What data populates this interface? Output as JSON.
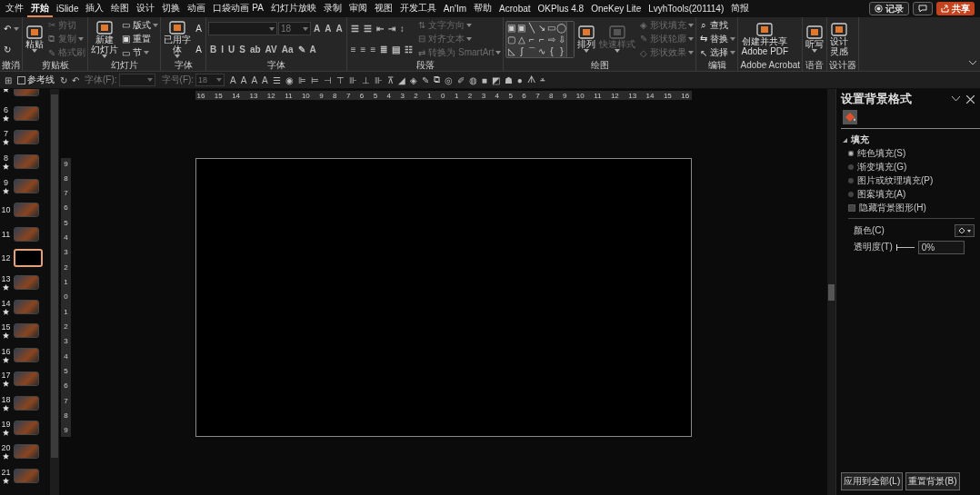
{
  "menu_tabs": [
    {
      "label": "文件",
      "selected": false
    },
    {
      "label": "开始",
      "selected": true
    },
    {
      "label": "iSlide",
      "selected": false
    },
    {
      "label": "插入",
      "selected": false
    },
    {
      "label": "绘图",
      "selected": false
    },
    {
      "label": "设计",
      "selected": false
    },
    {
      "label": "切换",
      "selected": false
    },
    {
      "label": "动画",
      "selected": false
    },
    {
      "label": "口袋动画 PA",
      "selected": false
    },
    {
      "label": "幻灯片放映",
      "selected": false
    },
    {
      "label": "录制",
      "selected": false
    },
    {
      "label": "审阅",
      "selected": false
    },
    {
      "label": "视图",
      "selected": false
    },
    {
      "label": "开发工具",
      "selected": false
    },
    {
      "label": "An'Im",
      "selected": false
    },
    {
      "label": "帮助",
      "selected": false
    },
    {
      "label": "Acrobat",
      "selected": false
    },
    {
      "label": "OKPlus 4.8",
      "selected": false
    },
    {
      "label": "OneKey Lite",
      "selected": false
    },
    {
      "label": "LvyhTools(201114)",
      "selected": false
    },
    {
      "label": "简报",
      "selected": false
    }
  ],
  "top_buttons": [
    {
      "kind": "record",
      "label": "记录"
    },
    {
      "kind": "comment"
    },
    {
      "kind": "share",
      "label": "共享"
    }
  ],
  "ribbon": {
    "groups": [
      {
        "label": "撤消",
        "columns": [
          [
            {
              "kind": "small",
              "glyph": "↶",
              "dropdown": true,
              "disabled": false
            },
            {
              "kind": "small",
              "glyph": "↻",
              "disabled": false
            }
          ]
        ]
      },
      {
        "label": "剪贴板",
        "columns": [
          [
            {
              "kind": "large",
              "lines": [
                "粘贴"
              ],
              "dropdown": true,
              "disabled": false
            }
          ],
          [
            {
              "kind": "small",
              "glyph": "✂",
              "label": "剪切",
              "disabled": true
            },
            {
              "kind": "small",
              "glyph": "⧉",
              "label": "复制",
              "dropdown": true,
              "disabled": true
            },
            {
              "kind": "small",
              "glyph": "✎",
              "label": "格式刷",
              "disabled": true
            }
          ]
        ]
      },
      {
        "label": "幻灯片",
        "columns": [
          [
            {
              "kind": "large",
              "lines": [
                "新建",
                "幻灯片"
              ],
              "dropdown": true,
              "disabled": false
            }
          ],
          [
            {
              "kind": "small",
              "glyph": "▭",
              "label": "版式",
              "dropdown": true,
              "disabled": false
            },
            {
              "kind": "small",
              "glyph": "▣",
              "label": "重置",
              "disabled": false
            },
            {
              "kind": "small",
              "glyph": "▭",
              "label": "节",
              "dropdown": true,
              "disabled": false
            }
          ]
        ]
      },
      {
        "label": "字体",
        "columns": [
          [
            {
              "kind": "large",
              "lines": [
                "已用字",
                "体"
              ],
              "dropdown": true,
              "disabled": false
            }
          ],
          [
            {
              "kind": "small",
              "glyph": "A",
              "disabled": false
            },
            {
              "kind": "small",
              "glyph": "A",
              "disabled": false
            }
          ]
        ]
      },
      {
        "label": "字体",
        "columns": [
          [
            {
              "kind": "row",
              "parts": [
                {
                  "kind": "field"
                },
                {
                  "kind": "field",
                  "value": "18"
                },
                {
                  "kind": "glyph",
                  "text": "A"
                },
                {
                  "kind": "glyph",
                  "text": "A"
                },
                {
                  "kind": "glyph",
                  "text": "A"
                }
              ]
            },
            {
              "kind": "row",
              "parts": [
                {
                  "kind": "glyph",
                  "text": "B"
                },
                {
                  "kind": "glyph",
                  "text": "I"
                },
                {
                  "kind": "glyph",
                  "text": "U"
                },
                {
                  "kind": "glyph",
                  "text": "S"
                },
                {
                  "kind": "glyph",
                  "text": "ab"
                },
                {
                  "kind": "glyph",
                  "text": "AV"
                },
                {
                  "kind": "glyph",
                  "text": "Aa"
                },
                {
                  "kind": "glyph",
                  "text": "✎"
                },
                {
                  "kind": "glyph",
                  "text": "A"
                }
              ]
            }
          ]
        ]
      },
      {
        "label": "段落",
        "columns": [
          [
            {
              "kind": "row",
              "parts": [
                {
                  "kind": "glyph",
                  "text": "☰"
                },
                {
                  "kind": "glyph",
                  "text": "☰"
                },
                {
                  "kind": "glyph",
                  "text": "⇤"
                },
                {
                  "kind": "glyph",
                  "text": "⇥"
                },
                {
                  "kind": "glyph",
                  "text": "↕"
                }
              ]
            },
            {
              "kind": "row",
              "parts": [
                {
                  "kind": "glyph",
                  "text": "≡"
                },
                {
                  "kind": "glyph",
                  "text": "≡"
                },
                {
                  "kind": "glyph",
                  "text": "≡"
                },
                {
                  "kind": "glyph",
                  "text": "≣"
                },
                {
                  "kind": "glyph",
                  "text": "▤"
                },
                {
                  "kind": "glyph",
                  "text": "☷"
                }
              ]
            }
          ],
          [
            {
              "kind": "small",
              "glyph": "⇅",
              "label": "文字方向",
              "dropdown": true,
              "disabled": true
            },
            {
              "kind": "small",
              "glyph": "⊟",
              "label": "对齐文本",
              "dropdown": true,
              "disabled": true
            },
            {
              "kind": "small",
              "glyph": "⇄",
              "label": "转换为 SmartArt",
              "dropdown": true,
              "disabled": true
            }
          ]
        ]
      },
      {
        "label": "绘图",
        "columns": [
          [
            {
              "kind": "gallery",
              "shapes": [
                "▣",
                "▣",
                "╲",
                "↘",
                "▭",
                "◯",
                "▢",
                "△",
                "⌐",
                "⌐",
                "⇨",
                "⇩",
                "◺",
                "ʃ",
                "⌒",
                "∿",
                "{",
                "}"
              ]
            }
          ],
          [
            {
              "kind": "large",
              "lines": [
                "排列"
              ],
              "dropdown": true,
              "disabled": false
            }
          ],
          [
            {
              "kind": "large",
              "lines": [
                "快速样式"
              ],
              "dropdown": true,
              "disabled": true
            }
          ],
          [
            {
              "kind": "small",
              "glyph": "◈",
              "label": "形状填充",
              "dropdown": true,
              "disabled": true
            },
            {
              "kind": "small",
              "glyph": "✎",
              "label": "形状轮廓",
              "dropdown": true,
              "disabled": true
            },
            {
              "kind": "small",
              "glyph": "◇",
              "label": "形状效果",
              "dropdown": true,
              "disabled": true
            }
          ]
        ]
      },
      {
        "label": "编辑",
        "columns": [
          [
            {
              "kind": "small",
              "glyph": "⌕",
              "label": "查找",
              "disabled": false
            },
            {
              "kind": "small",
              "glyph": "⇆",
              "label": "替换",
              "dropdown": true,
              "disabled": false
            },
            {
              "kind": "small",
              "glyph": "↖",
              "label": "选择",
              "dropdown": true,
              "disabled": false
            }
          ]
        ]
      },
      {
        "label": "Adobe Acrobat",
        "columns": [
          [
            {
              "kind": "large",
              "lines": [
                "创建并共享",
                "Adobe PDF"
              ],
              "disabled": false
            }
          ]
        ]
      },
      {
        "label": "语音",
        "columns": [
          [
            {
              "kind": "large",
              "lines": [
                "听写"
              ],
              "dropdown": true,
              "disabled": false
            }
          ]
        ]
      },
      {
        "label": "设计器",
        "columns": [
          [
            {
              "kind": "large",
              "lines": [
                "设计",
                "灵感"
              ],
              "disabled": false
            }
          ]
        ]
      }
    ]
  },
  "quick_toolbar": [
    {
      "kind": "glyph",
      "text": "⊞"
    },
    {
      "kind": "checkbox",
      "label": "参考线",
      "checked": false
    },
    {
      "kind": "glyph",
      "text": "↻"
    },
    {
      "kind": "glyph",
      "text": "↶"
    },
    {
      "kind": "field",
      "label": "字体(F):"
    },
    {
      "kind": "field",
      "label": "字号(F):",
      "value": "18"
    },
    {
      "kind": "glyph",
      "text": "A"
    },
    {
      "kind": "glyph",
      "text": "A"
    },
    {
      "kind": "glyph",
      "text": "A"
    },
    {
      "kind": "glyph",
      "text": "A"
    },
    {
      "kind": "glyph",
      "text": "☰"
    },
    {
      "kind": "glyph",
      "text": "◉"
    },
    {
      "kind": "glyph",
      "text": "⊫"
    },
    {
      "kind": "glyph",
      "text": "⊨"
    },
    {
      "kind": "glyph",
      "text": "⊣"
    },
    {
      "kind": "glyph",
      "text": "⊤"
    },
    {
      "kind": "glyph",
      "text": "⊪"
    },
    {
      "kind": "glyph",
      "text": "⊥"
    },
    {
      "kind": "glyph",
      "text": "⊪"
    },
    {
      "kind": "glyph",
      "text": "⊼"
    },
    {
      "kind": "glyph",
      "text": "◢"
    },
    {
      "kind": "glyph",
      "text": "◈"
    },
    {
      "kind": "glyph",
      "text": "✎"
    },
    {
      "kind": "glyph",
      "text": "⧉"
    },
    {
      "kind": "glyph",
      "text": "◎"
    },
    {
      "kind": "glyph",
      "text": "✐"
    },
    {
      "kind": "glyph",
      "text": "◍"
    },
    {
      "kind": "glyph",
      "text": "■"
    },
    {
      "kind": "glyph",
      "text": "◩"
    },
    {
      "kind": "glyph",
      "text": "☗"
    },
    {
      "kind": "glyph",
      "text": "●"
    },
    {
      "kind": "glyph",
      "text": "ᗑ"
    },
    {
      "kind": "glyph",
      "text": "⩡"
    }
  ],
  "slides": [
    {
      "starred": true,
      "selected": false
    },
    {
      "number": "6",
      "starred": true,
      "selected": false
    },
    {
      "number": "7",
      "starred": true,
      "selected": false
    },
    {
      "number": "8",
      "starred": true,
      "selected": false
    },
    {
      "number": "9",
      "starred": true,
      "selected": false
    },
    {
      "number": "10",
      "starred": false,
      "selected": false
    },
    {
      "number": "11",
      "starred": false,
      "selected": false
    },
    {
      "number": "12",
      "starred": false,
      "selected": true
    },
    {
      "number": "13",
      "starred": true,
      "selected": false
    },
    {
      "number": "14",
      "starred": true,
      "selected": false
    },
    {
      "number": "15",
      "starred": true,
      "selected": false
    },
    {
      "number": "16",
      "starred": true,
      "selected": false
    },
    {
      "number": "17",
      "starred": true,
      "selected": false
    },
    {
      "number": "18",
      "starred": true,
      "selected": false
    },
    {
      "number": "19",
      "starred": true,
      "selected": false
    },
    {
      "number": "20",
      "starred": true,
      "selected": false
    },
    {
      "number": "21",
      "starred": true,
      "selected": false
    }
  ],
  "ruler": {
    "horizontal": [
      "16",
      "15",
      "14",
      "13",
      "12",
      "11",
      "10",
      "9",
      "8",
      "7",
      "6",
      "5",
      "4",
      "3",
      "2",
      "1",
      "0",
      "1",
      "2",
      "3",
      "4",
      "5",
      "6",
      "7",
      "8",
      "9",
      "10",
      "11",
      "12",
      "13",
      "14",
      "15",
      "16"
    ],
    "vertical": [
      "9",
      "8",
      "7",
      "6",
      "5",
      "4",
      "3",
      "2",
      "1",
      "0",
      "1",
      "2",
      "3",
      "4",
      "5",
      "6",
      "7",
      "8",
      "9"
    ]
  },
  "format_pane": {
    "title": "设置背景格式",
    "section": {
      "label": "填充",
      "expanded": true
    },
    "fill_options": [
      {
        "label": "纯色填充(S)",
        "selected": true
      },
      {
        "label": "渐变填充(G)",
        "selected": false
      },
      {
        "label": "图片或纹理填充(P)",
        "selected": false
      },
      {
        "label": "图案填充(A)",
        "selected": false
      }
    ],
    "hide_graphics": {
      "label": "隐藏背景图形(H)",
      "checked": false
    },
    "color_label": "颜色(C)",
    "transparency": {
      "label": "透明度(T)",
      "level": 0,
      "value": "0%"
    },
    "buttons": [
      "应用到全部(L)",
      "重置背景(B)"
    ]
  }
}
